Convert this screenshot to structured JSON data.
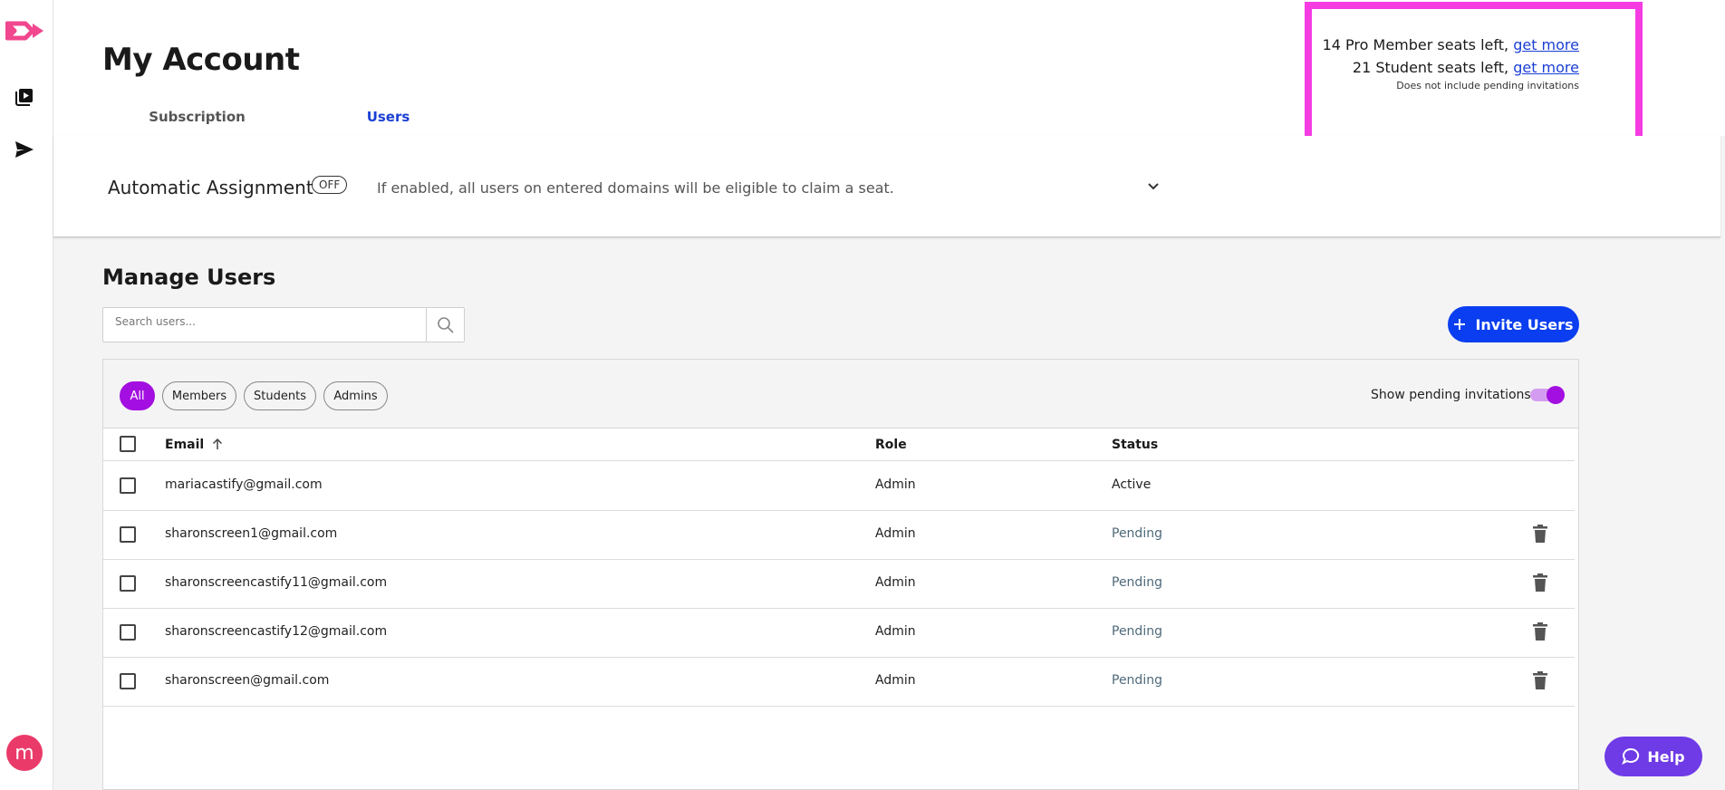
{
  "sidebar": {
    "logo_icon": "castify-logo-icon",
    "items": [
      {
        "icon": "video-library-icon"
      },
      {
        "icon": "send-icon"
      }
    ],
    "avatar_initial": "m",
    "avatar_color": "#ea3a69"
  },
  "header": {
    "title": "My Account",
    "tabs": [
      {
        "label": "Subscription",
        "active": false
      },
      {
        "label": "Users",
        "active": true
      }
    ]
  },
  "seats": {
    "pro_text": "14 Pro Member seats left,",
    "student_text": "21 Student seats left,",
    "get_more_label": "get more",
    "note": "Does not include pending invitations",
    "highlight_color": "#f43ce2"
  },
  "automatic_assignment": {
    "title": "Automatic Assignment",
    "state_badge": "OFF",
    "description": "If enabled, all users on entered domains will be eligible to claim a seat."
  },
  "manage_users": {
    "title": "Manage Users",
    "search_placeholder": "Search users...",
    "invite_label": "Invite Users",
    "filters": [
      {
        "label": "All",
        "active": true
      },
      {
        "label": "Members",
        "active": false
      },
      {
        "label": "Students",
        "active": false
      },
      {
        "label": "Admins",
        "active": false
      }
    ],
    "show_pending_label": "Show pending invitations",
    "show_pending_on": true,
    "columns": {
      "email": "Email",
      "role": "Role",
      "status": "Status"
    },
    "rows": [
      {
        "email": "mariacastify@gmail.com",
        "role": "Admin",
        "status": "Active"
      },
      {
        "email": "sharonscreen1@gmail.com",
        "role": "Admin",
        "status": "Pending"
      },
      {
        "email": "sharonscreencastify11@gmail.com",
        "role": "Admin",
        "status": "Pending"
      },
      {
        "email": "sharonscreencastify12@gmail.com",
        "role": "Admin",
        "status": "Pending"
      },
      {
        "email": "sharonscreen@gmail.com",
        "role": "Admin",
        "status": "Pending"
      }
    ]
  },
  "help": {
    "label": "Help"
  },
  "colors": {
    "accent_blue": "#0a3ef0",
    "accent_purple": "#a30fe0",
    "help_purple": "#6f3be6"
  }
}
